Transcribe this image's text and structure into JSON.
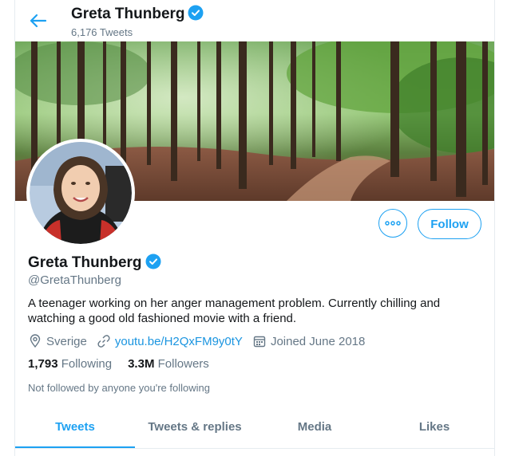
{
  "header": {
    "name": "Greta Thunberg",
    "tweet_count": "6,176 Tweets"
  },
  "profile": {
    "name": "Greta Thunberg",
    "handle": "@GretaThunberg",
    "bio": "A teenager working on her anger management problem. Currently chilling and watching a good old fashioned movie with a friend.",
    "location": "Sverige",
    "website": "youtu.be/H2QxFM9y0tY",
    "joined": "Joined June 2018",
    "following_count": "1,793",
    "following_label": "Following",
    "followers_count": "3.3M",
    "followers_label": "Followers",
    "not_followed_text": "Not followed by anyone you're following"
  },
  "actions": {
    "more_icon": "more-icon",
    "follow_label": "Follow"
  },
  "tabs": [
    {
      "label": "Tweets",
      "active": true
    },
    {
      "label": "Tweets & replies",
      "active": false
    },
    {
      "label": "Media",
      "active": false
    },
    {
      "label": "Likes",
      "active": false
    }
  ],
  "colors": {
    "accent": "#1da1f2",
    "secondary_text": "#657786",
    "link": "#1b95e0"
  }
}
